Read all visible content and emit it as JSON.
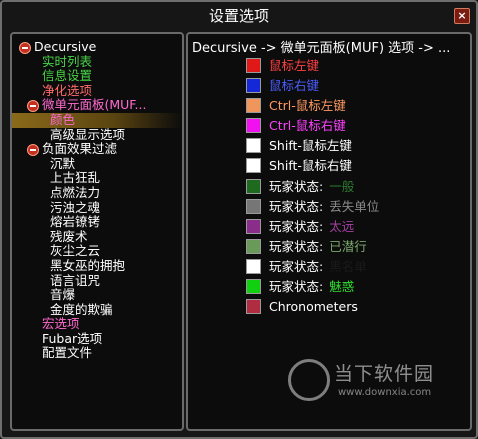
{
  "window": {
    "title": "设置选项",
    "close_label": "×"
  },
  "tree": [
    {
      "label": "Decursive",
      "color": "#ffffff",
      "indent": 0,
      "toggle": true,
      "selected": false,
      "name": "tree-item-decursive"
    },
    {
      "label": "实时列表",
      "color": "#47d447",
      "indent": 1,
      "toggle": false,
      "selected": false,
      "name": "tree-item-live-list"
    },
    {
      "label": "信息设置",
      "color": "#47d447",
      "indent": 1,
      "toggle": false,
      "selected": false,
      "name": "tree-item-info-settings"
    },
    {
      "label": "净化选项",
      "color": "#ff6a6a",
      "indent": 1,
      "toggle": false,
      "selected": false,
      "name": "tree-item-cure-options"
    },
    {
      "label": "微单元面板(MUF...",
      "color": "#ff6ad0",
      "indent": 1,
      "toggle": true,
      "selected": false,
      "name": "tree-item-muf"
    },
    {
      "label": "颜色",
      "color": "#ff6ad0",
      "indent": 2,
      "toggle": false,
      "selected": true,
      "name": "tree-item-colors"
    },
    {
      "label": "高级显示选项",
      "color": "#ffffff",
      "indent": 2,
      "toggle": false,
      "selected": false,
      "name": "tree-item-advanced-display"
    },
    {
      "label": "负面效果过滤",
      "color": "#ffffff",
      "indent": 1,
      "toggle": true,
      "selected": false,
      "name": "tree-item-debuff-filter"
    },
    {
      "label": "沉默",
      "color": "#ffffff",
      "indent": 2,
      "toggle": false,
      "selected": false,
      "name": "tree-item-debuff"
    },
    {
      "label": "上古狂乱",
      "color": "#ffffff",
      "indent": 2,
      "toggle": false,
      "selected": false,
      "name": "tree-item-debuff"
    },
    {
      "label": "点燃法力",
      "color": "#ffffff",
      "indent": 2,
      "toggle": false,
      "selected": false,
      "name": "tree-item-debuff"
    },
    {
      "label": "污浊之魂",
      "color": "#ffffff",
      "indent": 2,
      "toggle": false,
      "selected": false,
      "name": "tree-item-debuff"
    },
    {
      "label": "熔岩镣铐",
      "color": "#ffffff",
      "indent": 2,
      "toggle": false,
      "selected": false,
      "name": "tree-item-debuff"
    },
    {
      "label": "残废术",
      "color": "#ffffff",
      "indent": 2,
      "toggle": false,
      "selected": false,
      "name": "tree-item-debuff"
    },
    {
      "label": "灰尘之云",
      "color": "#ffffff",
      "indent": 2,
      "toggle": false,
      "selected": false,
      "name": "tree-item-debuff"
    },
    {
      "label": "黑女巫的拥抱",
      "color": "#ffffff",
      "indent": 2,
      "toggle": false,
      "selected": false,
      "name": "tree-item-debuff"
    },
    {
      "label": "语言诅咒",
      "color": "#ffffff",
      "indent": 2,
      "toggle": false,
      "selected": false,
      "name": "tree-item-debuff"
    },
    {
      "label": "音爆",
      "color": "#ffffff",
      "indent": 2,
      "toggle": false,
      "selected": false,
      "name": "tree-item-debuff"
    },
    {
      "label": "金度的欺骗",
      "color": "#ffffff",
      "indent": 2,
      "toggle": false,
      "selected": false,
      "name": "tree-item-debuff"
    },
    {
      "label": "宏选项",
      "color": "#ff6ad0",
      "indent": 1,
      "toggle": false,
      "selected": false,
      "name": "tree-item-macro"
    },
    {
      "label": "Fubar选项",
      "color": "#ffffff",
      "indent": 1,
      "toggle": false,
      "selected": false,
      "name": "tree-item-fubar"
    },
    {
      "label": "配置文件",
      "color": "#ffffff",
      "indent": 1,
      "toggle": false,
      "selected": false,
      "name": "tree-item-profiles"
    }
  ],
  "right_header": "Decursive -> 微单元面板(MUF) 选项 -> ...",
  "options": [
    {
      "swatch": "#e01818",
      "prefix": "",
      "label": "鼠标左键",
      "label_color": "#ff4040"
    },
    {
      "swatch": "#1428d8",
      "prefix": "",
      "label": "鼠标右键",
      "label_color": "#4a5cff"
    },
    {
      "swatch": "#f0965a",
      "prefix": "",
      "label": "Ctrl-鼠标左键",
      "label_color": "#ff9a60"
    },
    {
      "swatch": "#f010f0",
      "prefix": "",
      "label": "Ctrl-鼠标右键",
      "label_color": "#ff40ff"
    },
    {
      "swatch": "#ffffff",
      "prefix": "",
      "label": "Shift-鼠标左键",
      "label_color": "#ffffff"
    },
    {
      "swatch": "#ffffff",
      "prefix": "",
      "label": "Shift-鼠标右键",
      "label_color": "#ffffff"
    },
    {
      "swatch": "#1e6a1e",
      "prefix": "玩家状态:",
      "label": "一般",
      "label_color": "#2e7a2e"
    },
    {
      "swatch": "#767676",
      "prefix": "玩家状态:",
      "label": "丢失单位",
      "label_color": "#8a8a8a"
    },
    {
      "swatch": "#8a2c8a",
      "prefix": "玩家状态:",
      "label": "太远",
      "label_color": "#a040a0"
    },
    {
      "swatch": "#6a9a5a",
      "prefix": "玩家状态:",
      "label": "已潜行",
      "label_color": "#7aa86a"
    },
    {
      "swatch": "#ffffff",
      "prefix": "玩家状态:",
      "label": "黑名单",
      "label_color": "#1a1a1a"
    },
    {
      "swatch": "#10d010",
      "prefix": "玩家状态:",
      "label": "魅惑",
      "label_color": "#30e030"
    },
    {
      "swatch": "#b02c40",
      "prefix": "",
      "label": "Chronometers",
      "label_color": "#ffffff"
    }
  ],
  "watermark": {
    "text": "当下软件园",
    "url": "www.downxia.com"
  }
}
